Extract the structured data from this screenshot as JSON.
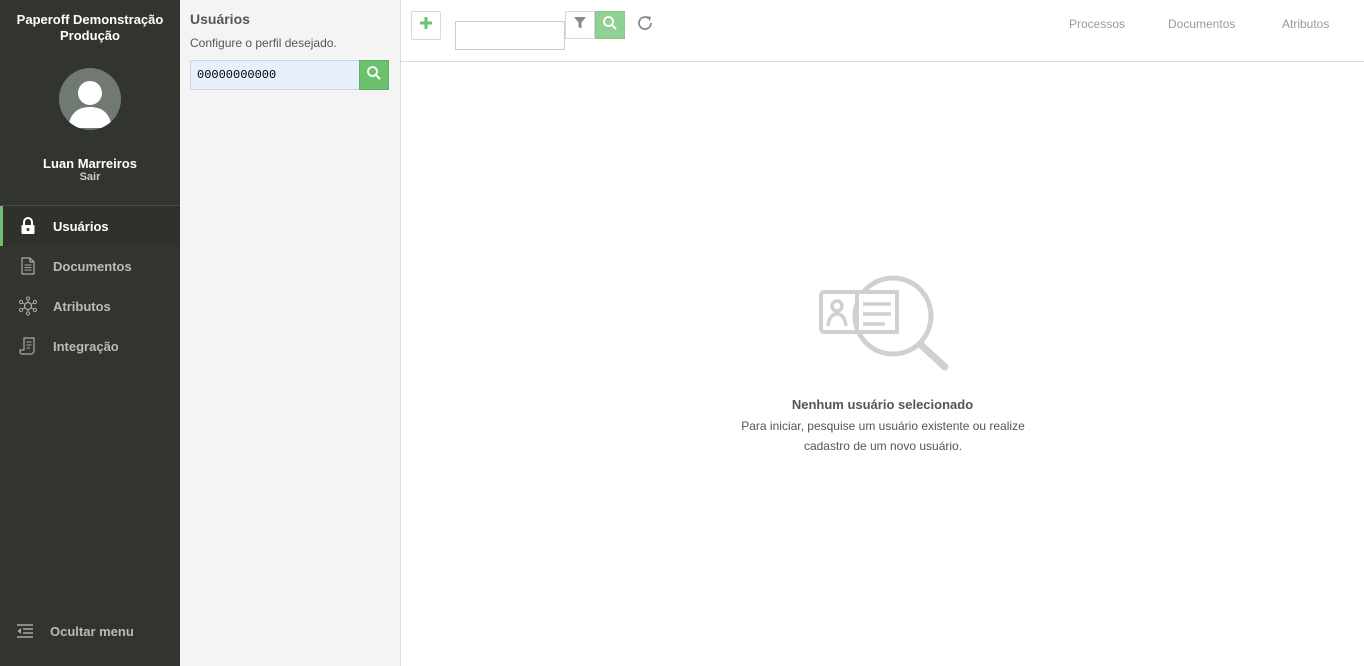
{
  "sidebar": {
    "app_title": "Paperoff Demonstração Produção",
    "user_name": "Luan Marreiros",
    "logout": "Sair",
    "items": [
      {
        "label": "Usuários",
        "icon": "lock-icon",
        "active": true
      },
      {
        "label": "Documentos",
        "icon": "document-icon",
        "active": false
      },
      {
        "label": "Atributos",
        "icon": "network-icon",
        "active": false
      },
      {
        "label": "Integração",
        "icon": "integration-icon",
        "active": false
      }
    ],
    "hide_menu": "Ocultar menu"
  },
  "panel": {
    "title": "Usuários",
    "subtitle": "Configure o perfil desejado.",
    "search_value": "00000000000"
  },
  "toolbar": {
    "search_value": "",
    "tabs": [
      "Processos",
      "Documentos",
      "Atributos"
    ]
  },
  "empty_state": {
    "title": "Nenhum usuário selecionado",
    "text": "Para iniciar, pesquise um usuário existente ou realize cadastro de um novo usuário."
  },
  "colors": {
    "sidebar_bg": "#323430",
    "accent_green": "#6cc16f",
    "panel_bg": "#f4f4f4"
  }
}
